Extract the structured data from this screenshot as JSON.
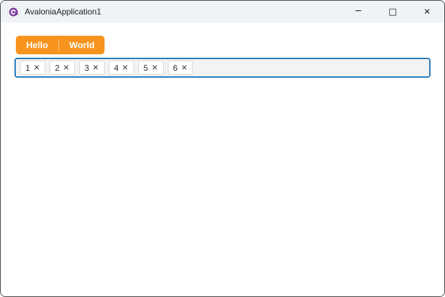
{
  "window": {
    "title": "AvaloniaApplication1",
    "app_icon": "avalonia-logo",
    "controls": {
      "minimize_glyph": "─",
      "maximize_glyph": "□",
      "close_glyph": "✕"
    }
  },
  "tabstrip": {
    "accent_color": "#F7941E",
    "tabs": [
      {
        "label": "Hello"
      },
      {
        "label": "World"
      }
    ]
  },
  "chipbox": {
    "border_color": "#2779B8",
    "background_color": "#f1f3f5",
    "close_glyph": "✕",
    "chips": [
      {
        "label": "1"
      },
      {
        "label": "2"
      },
      {
        "label": "3"
      },
      {
        "label": "4"
      },
      {
        "label": "5"
      },
      {
        "label": "6"
      }
    ]
  },
  "colors": {
    "titlebar_background": "#eff3f6",
    "window_border": "#3f3f3f",
    "logo_purple": "#7d3f9d"
  }
}
